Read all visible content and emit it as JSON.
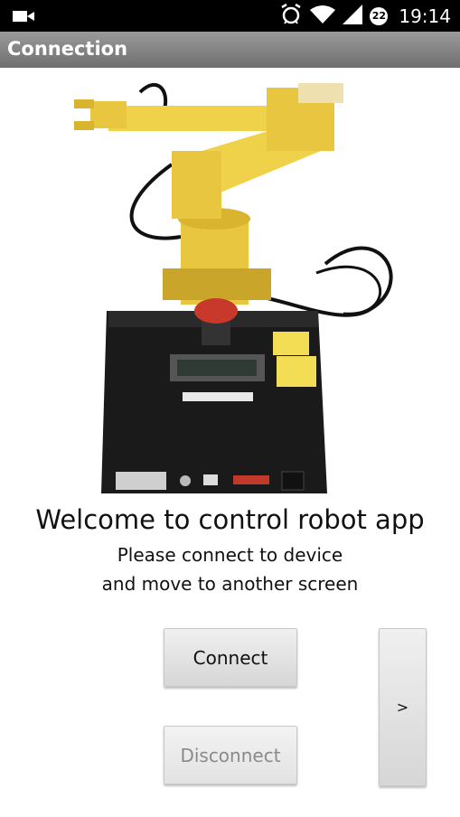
{
  "status_bar": {
    "time": "19:14",
    "notification_count": "22",
    "icons": [
      "video-camera-icon",
      "alarm-icon",
      "wifi-icon",
      "signal-icon"
    ]
  },
  "title_bar": {
    "title": "Connection"
  },
  "main": {
    "image_alt": "robot-arm-photo",
    "welcome": "Welcome to control robot app",
    "subtitle_line1": "Please connect to device",
    "subtitle_line2": "and move to another screen"
  },
  "buttons": {
    "connect": "Connect",
    "disconnect": "Disconnect",
    "next": ">"
  },
  "colors": {
    "title_bar": "#7f7f7f",
    "robot_yellow": "#f0d24a",
    "base_black": "#1a1a1a",
    "estop_red": "#c8392b"
  }
}
